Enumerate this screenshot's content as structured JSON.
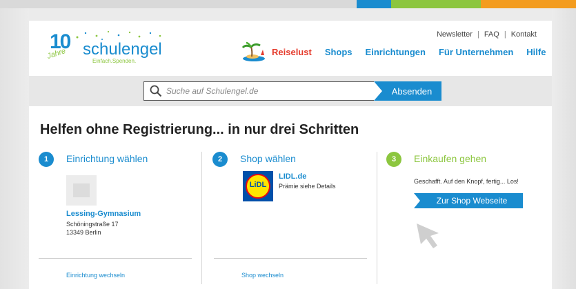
{
  "brand": {
    "logo_number": "10",
    "logo_jahre": "Jahre",
    "logo_word": "schulengel",
    "logo_tagline": "Einfach.Spenden."
  },
  "top_links": [
    "Newsletter",
    "FAQ",
    "Kontakt"
  ],
  "nav": [
    "Reiselust",
    "Shops",
    "Einrichtungen",
    "Für Unternehmen",
    "Hilfe"
  ],
  "search": {
    "placeholder": "Suche auf Schulengel.de",
    "button": "Absenden"
  },
  "heading": "Helfen ohne Registrierung... in nur drei Schritten",
  "steps": [
    {
      "number": "1",
      "title": "Einrichtung wählen",
      "name": "Lessing-Gymnasium",
      "address_line1": "Schöningstraße 17",
      "address_line2": "13349 Berlin",
      "link": "Einrichtung wechseln"
    },
    {
      "number": "2",
      "title": "Shop wählen",
      "shop_logo_text": "LiDL",
      "name": "LIDL.de",
      "prize": "Prämie siehe Details",
      "link": "Shop wechseln"
    },
    {
      "number": "3",
      "title": "Einkaufen gehen",
      "text": "Geschafft. Auf den Knopf, fertig... Los!",
      "button": "Zur Shop Webseite"
    }
  ],
  "colors": {
    "accent_blue": "#1a8ccf",
    "accent_green": "#8cc63f",
    "accent_orange": "#f39c1f",
    "accent_red": "#e53b2c"
  }
}
